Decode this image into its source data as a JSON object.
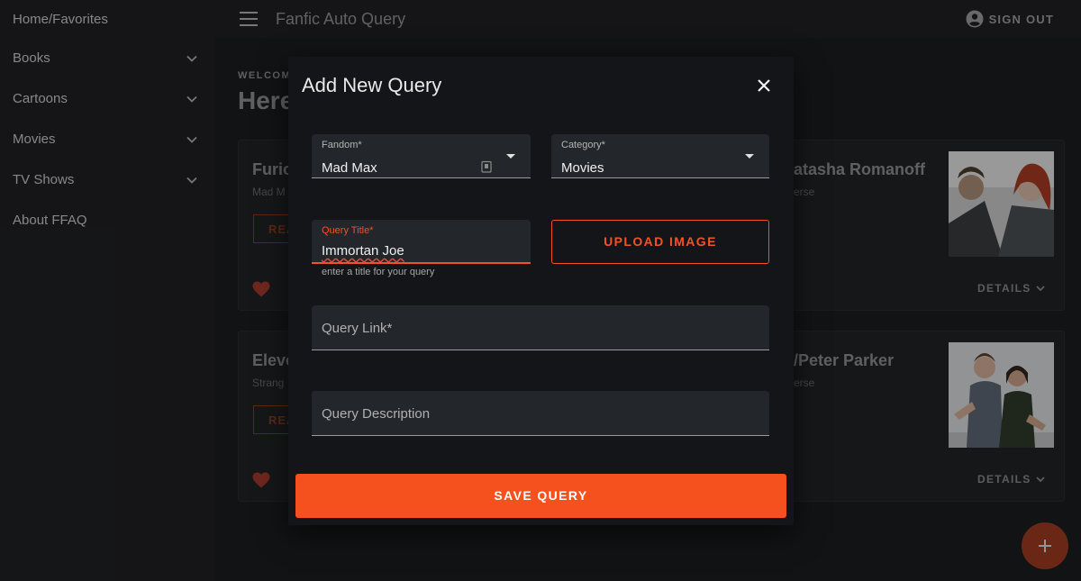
{
  "sidebar": {
    "items": [
      {
        "label": "Home/Favorites",
        "expandable": false
      },
      {
        "label": "Books",
        "expandable": true
      },
      {
        "label": "Cartoons",
        "expandable": true
      },
      {
        "label": "Movies",
        "expandable": true
      },
      {
        "label": "TV Shows",
        "expandable": true
      },
      {
        "label": "About FFAQ",
        "expandable": false
      }
    ]
  },
  "appbar": {
    "title": "Fanfic Auto Query",
    "signout_label": "SIGN OUT",
    "menu_icon": "menu-icon",
    "account_icon": "account-circle-icon"
  },
  "background": {
    "welcome": "WELCOM",
    "heading": "Here",
    "cards": [
      {
        "title": "Furio",
        "subtitle": "Mad M",
        "read_label": "REA",
        "details_label": "DETAILS"
      },
      {
        "title": "atasha Romanoff",
        "subtitle": "erse",
        "details_label": "DETAILS"
      },
      {
        "title": "Eleve",
        "subtitle": "Strang",
        "read_label": "REA",
        "details_label": "DETAILS"
      },
      {
        "title": "/Peter Parker",
        "subtitle": "erse",
        "details_label": "DETAILS"
      }
    ]
  },
  "dialog": {
    "title": "Add New Query",
    "fandom": {
      "label": "Fandom*",
      "value": "Mad Max"
    },
    "category": {
      "label": "Category*",
      "value": "Movies"
    },
    "query_title": {
      "label": "Query Title*",
      "value": "Immortan Joe",
      "helper": "enter a title for your query"
    },
    "upload_label": "UPLOAD IMAGE",
    "query_link": {
      "label": "Query Link*"
    },
    "query_description": {
      "label": "Query Description"
    },
    "save_label": "SAVE QUERY"
  },
  "colors": {
    "accent": "#f4511e",
    "background": "#1b1c1e",
    "dialog": "#131518",
    "field": "#23262a"
  }
}
